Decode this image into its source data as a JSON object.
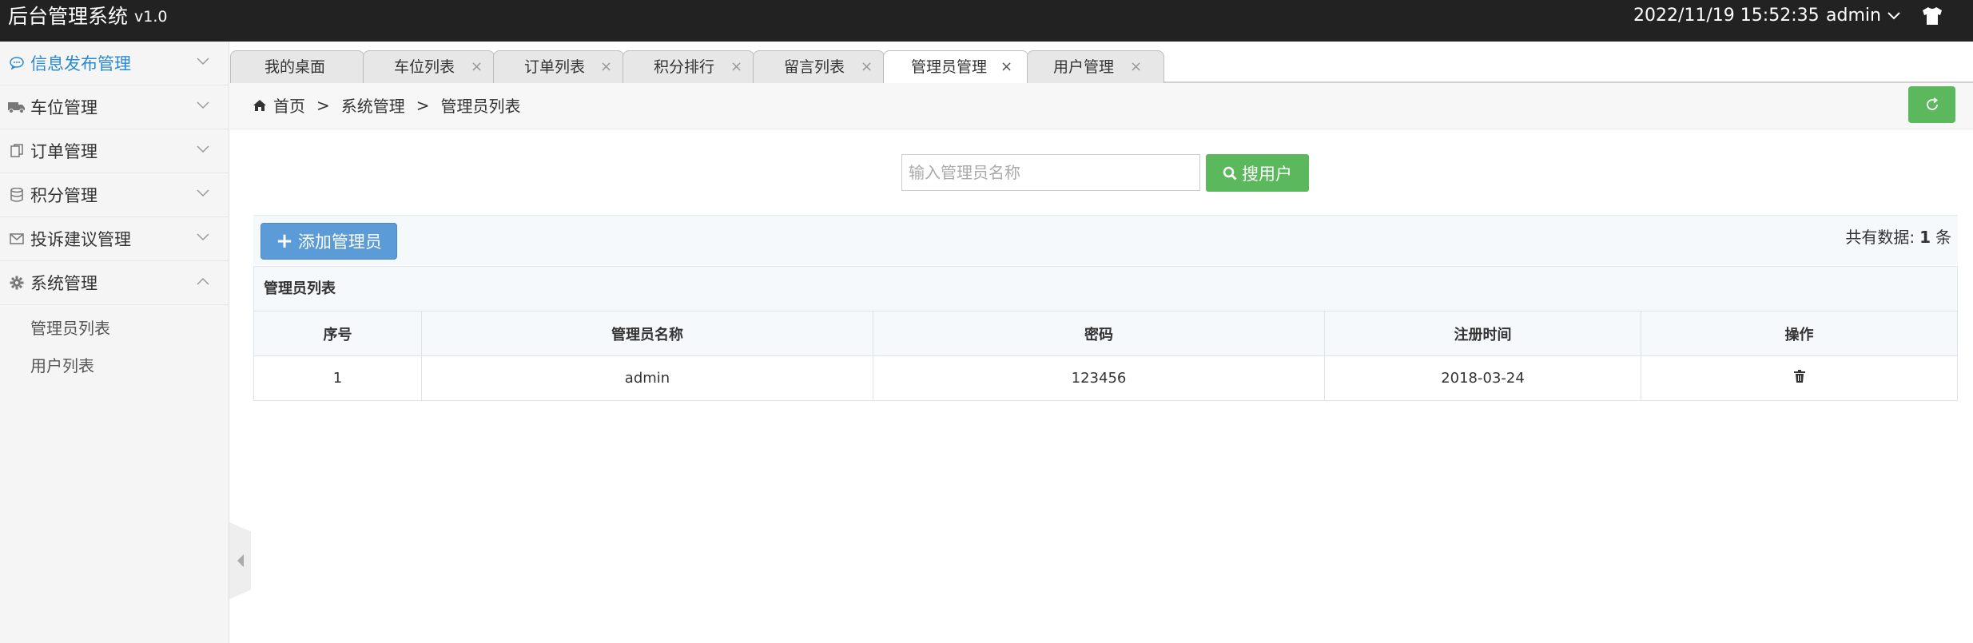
{
  "header": {
    "title": "后台管理系统",
    "version": "v1.0",
    "datetime": "2022/11/19 15:52:35",
    "username": "admin"
  },
  "sidebar": {
    "items": [
      {
        "label": "信息发布管理",
        "icon": "chat-icon",
        "active": true
      },
      {
        "label": "车位管理",
        "icon": "truck-icon"
      },
      {
        "label": "订单管理",
        "icon": "copy-icon"
      },
      {
        "label": "积分管理",
        "icon": "database-icon"
      },
      {
        "label": "投诉建议管理",
        "icon": "envelope-icon"
      },
      {
        "label": "系统管理",
        "icon": "gear-icon",
        "expanded": true
      }
    ],
    "subitems": [
      "管理员列表",
      "用户列表"
    ]
  },
  "tabs": [
    {
      "label": "我的桌面",
      "closable": false
    },
    {
      "label": "车位列表",
      "close": "×"
    },
    {
      "label": "订单列表",
      "close": "×"
    },
    {
      "label": "积分排行",
      "close": "×"
    },
    {
      "label": "留言列表",
      "close": "×"
    },
    {
      "label": "管理员管理",
      "close": "×",
      "active": true
    },
    {
      "label": "用户管理",
      "close": "×"
    }
  ],
  "breadcrumb": {
    "home": "首页",
    "sep1": ">",
    "level2": "系统管理",
    "sep2": ">",
    "current": "管理员列表"
  },
  "search": {
    "placeholder": "输入管理员名称",
    "value": "",
    "button_label": "搜用户"
  },
  "toolbar": {
    "add_label": "添加管理员",
    "total_prefix": "共有数据:",
    "total_count": "1",
    "total_suffix": "条"
  },
  "table": {
    "caption": "管理员列表",
    "headers": [
      "序号",
      "管理员名称",
      "密码",
      "注册时间",
      "操作"
    ],
    "rows": [
      [
        "1",
        "admin",
        "123456",
        "2018-03-24"
      ]
    ]
  },
  "colors": {
    "header_bg": "#222222",
    "active_link": "#2a8ad3",
    "success": "#5cb85c",
    "primary": "#5a9bd8"
  }
}
